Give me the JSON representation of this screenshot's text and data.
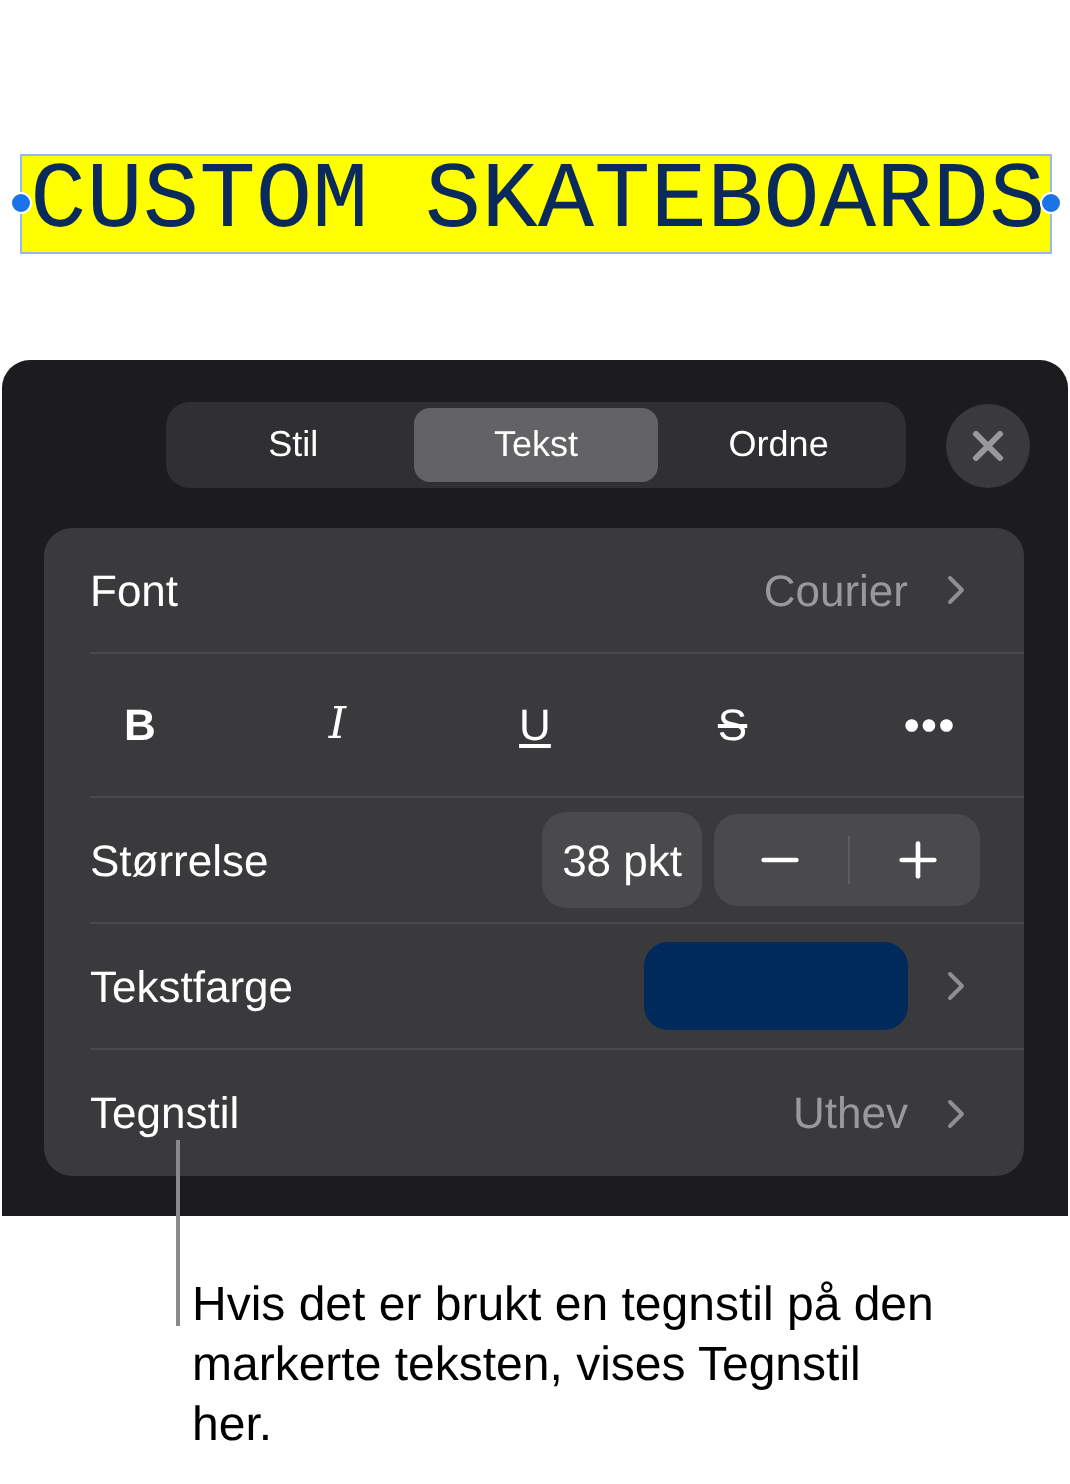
{
  "heading": {
    "text": "CUSTOM SKATEBOARDS"
  },
  "tabs": [
    {
      "label": "Stil",
      "selected": false
    },
    {
      "label": "Tekst",
      "selected": true
    },
    {
      "label": "Ordne",
      "selected": false
    }
  ],
  "rows": [
    {
      "kind": "value",
      "label": "Font",
      "value": "Courier"
    },
    {
      "kind": "styles",
      "buttons": [
        {
          "label": "B",
          "kind": "bold"
        },
        {
          "label": "I",
          "kind": "italic"
        },
        {
          "label": "U",
          "kind": "underline"
        },
        {
          "label": "S",
          "kind": "strike"
        },
        {
          "label": "•••",
          "kind": "more"
        }
      ]
    },
    {
      "kind": "size",
      "label": "Størrelse",
      "value": "38 pkt"
    },
    {
      "kind": "color",
      "label": "Tekstfarge",
      "color": "#002a5c"
    },
    {
      "kind": "value",
      "label": "Tegnstil",
      "value": "Uthev"
    }
  ],
  "callout": "Hvis det er brukt en tegnstil på den markerte teksten, vises Tegnstil her."
}
